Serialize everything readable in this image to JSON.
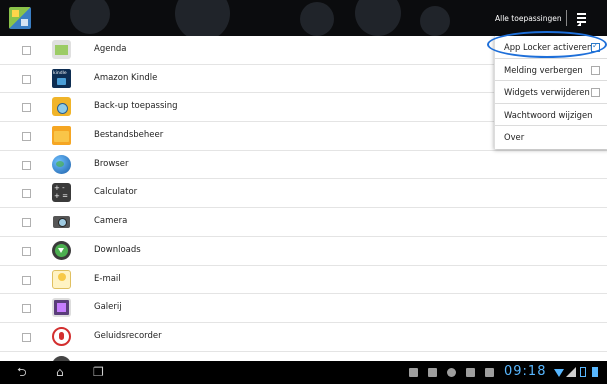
{
  "header": {
    "section_title": "Alle toepassingen",
    "app_icon": "app-locker-icon",
    "menu_icon": "overflow-menu-icon"
  },
  "apps": [
    {
      "label": "Agenda",
      "icon": "calendar-icon",
      "checked": false
    },
    {
      "label": "Amazon Kindle",
      "icon": "kindle-icon",
      "checked": false
    },
    {
      "label": "Back-up toepassing",
      "icon": "backup-icon",
      "checked": false
    },
    {
      "label": "Bestandsbeheer",
      "icon": "folder-icon",
      "checked": false
    },
    {
      "label": "Browser",
      "icon": "globe-icon",
      "checked": false
    },
    {
      "label": "Calculator",
      "icon": "calculator-icon",
      "checked": false
    },
    {
      "label": "Camera",
      "icon": "camera-icon",
      "checked": false
    },
    {
      "label": "Downloads",
      "icon": "download-icon",
      "checked": false
    },
    {
      "label": "E-mail",
      "icon": "email-icon",
      "checked": false
    },
    {
      "label": "Galerij",
      "icon": "gallery-icon",
      "checked": false
    },
    {
      "label": "Geluidsrecorder",
      "icon": "microphone-icon",
      "checked": false
    },
    {
      "label": "",
      "icon": "app-icon",
      "checked": false
    }
  ],
  "menu": {
    "items": [
      {
        "label": "App Locker activeren",
        "has_checkbox": true,
        "checked": true
      },
      {
        "label": "Melding verbergen",
        "has_checkbox": true,
        "checked": false
      },
      {
        "label": "Widgets verwijderen",
        "has_checkbox": true,
        "checked": false
      },
      {
        "label": "Wachtwoord wijzigen",
        "has_checkbox": false
      },
      {
        "label": "Over",
        "has_checkbox": false
      }
    ]
  },
  "navbar": {
    "clock": "09:18",
    "buttons": [
      "back-icon",
      "home-icon",
      "recent-apps-icon"
    ],
    "accent_color": "#58b7ff"
  }
}
